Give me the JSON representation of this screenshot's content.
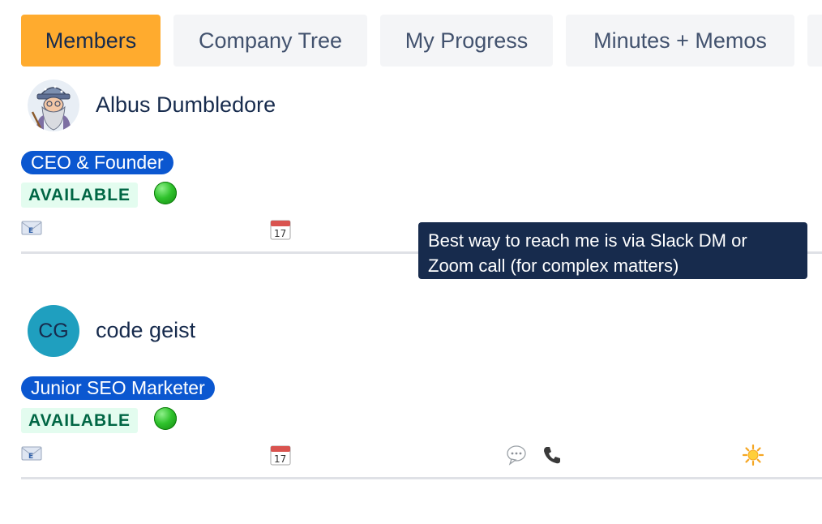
{
  "tabs": [
    {
      "label": "Members",
      "active": true
    },
    {
      "label": "Company Tree",
      "active": false
    },
    {
      "label": "My Progress",
      "active": false
    },
    {
      "label": "Minutes + Memos",
      "active": false
    }
  ],
  "members": [
    {
      "name": "Albus Dumbledore",
      "avatar": "wizard-illustration",
      "role": "CEO & Founder",
      "status": "AVAILABLE",
      "status_indicator": "green-circle",
      "actions": [
        "email-icon",
        "calendar-icon"
      ]
    },
    {
      "name": "code geist",
      "avatar_initials": "CG",
      "role": "Junior SEO Marketer",
      "status": "AVAILABLE",
      "status_indicator": "green-circle",
      "actions": [
        "email-icon",
        "calendar-icon",
        "speech-bubble-icon",
        "phone-icon",
        "sun-icon"
      ]
    }
  ],
  "tooltip": {
    "text": "Best way to reach me is via Slack DM or Zoom call (for complex matters)"
  },
  "colors": {
    "active_tab": "#ffab2e",
    "role_badge": "#0b57d0",
    "status_badge_bg": "#e3fcef",
    "status_badge_text": "#006644",
    "tooltip_bg": "#172b4d",
    "avatar_initials_bg": "#1f9fbf"
  }
}
